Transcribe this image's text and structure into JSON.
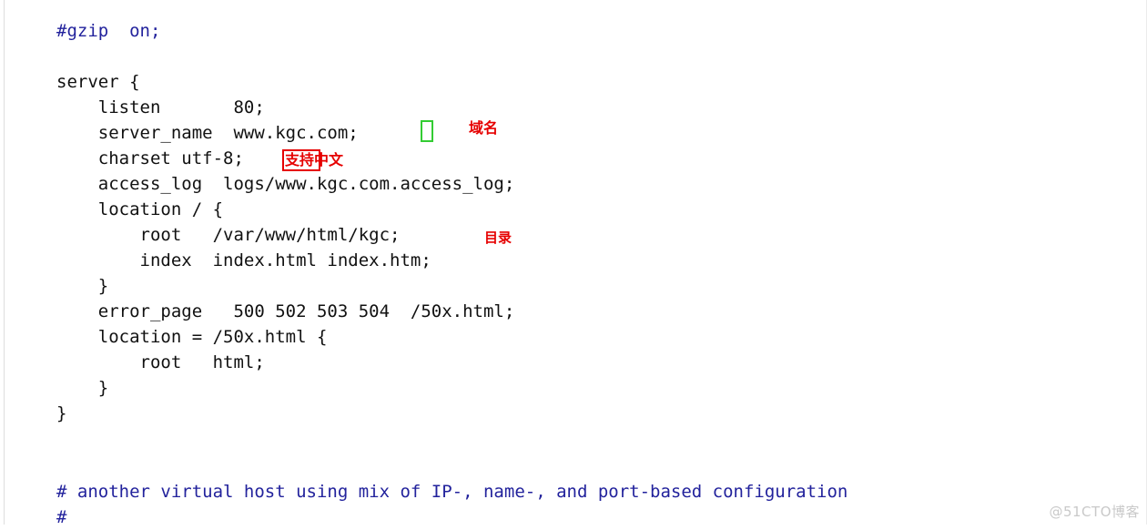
{
  "editor": {
    "background_color": "#ffffff",
    "code_color": "#111111",
    "comment_color": "#22229c",
    "top_block": [
      {
        "text": "#gzip  on;",
        "kind": "comment"
      },
      {
        "text": "",
        "kind": "code"
      },
      {
        "text": "server {",
        "kind": "code"
      },
      {
        "text": "    listen       80;",
        "kind": "code"
      },
      {
        "text": "    server_name  www.kgc.com;",
        "kind": "code"
      },
      {
        "text": "    charset utf-8;",
        "kind": "code"
      },
      {
        "text": "    access_log  logs/www.kgc.com.access_log;",
        "kind": "code"
      },
      {
        "text": "    location / {",
        "kind": "code"
      },
      {
        "text": "        root   /var/www/html/kgc;",
        "kind": "code"
      },
      {
        "text": "        index  index.html index.htm;",
        "kind": "code"
      },
      {
        "text": "    }",
        "kind": "code"
      },
      {
        "text": "    error_page   500 502 503 504  /50x.html;",
        "kind": "code"
      },
      {
        "text": "    location = /50x.html {",
        "kind": "code"
      },
      {
        "text": "        root   html;",
        "kind": "code"
      },
      {
        "text": "    }",
        "kind": "code"
      },
      {
        "text": "}",
        "kind": "code"
      }
    ],
    "bottom_block": [
      {
        "text": "# another virtual host using mix of IP-, name-, and port-based configuration",
        "kind": "comment"
      },
      {
        "text": "#",
        "kind": "comment"
      }
    ]
  },
  "annotations": {
    "color_red": "#e60000",
    "color_green": "#33cc33",
    "domain_label": "域名",
    "charset_label": "支持中文",
    "directory_label": "目录",
    "green_box_label": "",
    "red_box_label": ""
  },
  "watermark": {
    "text": "@51CTO博客",
    "color": "#c9c9c9"
  }
}
